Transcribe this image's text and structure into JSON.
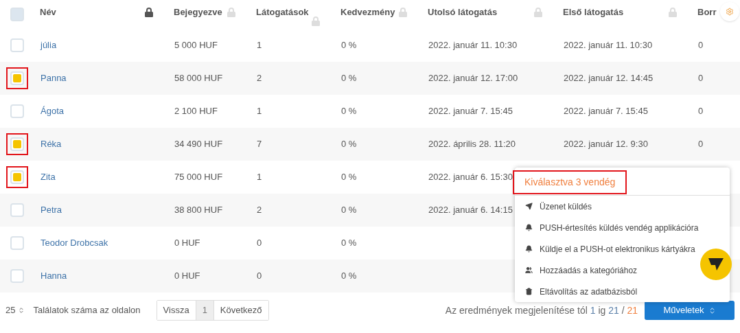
{
  "header_checkbox": {
    "checked": false
  },
  "columns": [
    {
      "label": "Név",
      "locked": true
    },
    {
      "label": "Bejegyezve",
      "locked": false
    },
    {
      "label": "Látogatások",
      "locked": false
    },
    {
      "label": "Kedvezmény",
      "locked": false
    },
    {
      "label": "Utolsó látogatás",
      "locked": false
    },
    {
      "label": "Első látogatás",
      "locked": false
    },
    {
      "label": "Borr"
    }
  ],
  "rows": [
    {
      "checked": false,
      "cells": [
        "júlia",
        "5 000 HUF",
        "1",
        "0 %",
        "2022. január 11. 10:30",
        "2022. január 11. 10:30",
        "0"
      ]
    },
    {
      "checked": true,
      "cells": [
        "Panna",
        "58 000 HUF",
        "2",
        "0 %",
        "2022. január 12. 17:00",
        "2022. január 12. 14:45",
        "0"
      ]
    },
    {
      "checked": false,
      "cells": [
        "Ágota",
        "2 100 HUF",
        "1",
        "0 %",
        "2022. január 7. 15:45",
        "2022. január 7. 15:45",
        "0"
      ]
    },
    {
      "checked": true,
      "cells": [
        "Réka",
        "34 490 HUF",
        "7",
        "0 %",
        "2022. április 28. 11:20",
        "2022. január 12. 9:30",
        "0"
      ]
    },
    {
      "checked": true,
      "cells": [
        "Zita",
        "75 000 HUF",
        "1",
        "0 %",
        "2022. január 6. 15:30",
        null,
        null
      ]
    },
    {
      "checked": false,
      "cells": [
        "Petra",
        "38 800 HUF",
        "2",
        "0 %",
        "2022. január 6. 14:15",
        null,
        null
      ]
    },
    {
      "checked": false,
      "cells": [
        "Teodor Drobcsak",
        "0 HUF",
        "0",
        "0 %",
        null,
        null,
        null
      ]
    },
    {
      "checked": false,
      "cells": [
        "Hanna",
        "0 HUF",
        "0",
        "0 %",
        null,
        null,
        null
      ]
    }
  ],
  "menu": {
    "title": "Kiválasztva 3 vendég",
    "items": [
      {
        "kind": "send",
        "label": "Üzenet küldés"
      },
      {
        "kind": "bell",
        "label": "PUSH-értesítés küldés vendég applikációra"
      },
      {
        "kind": "bell",
        "label": "Küldje el a PUSH-ot elektronikus kártyákra"
      },
      {
        "kind": "users",
        "label": "Hozzáadás a kategóriához"
      },
      {
        "kind": "trash",
        "label": "Eltávolítás az adatbázisból"
      }
    ]
  },
  "footer": {
    "page_size": "25",
    "page_size_label": "Találatok száma az oldalon",
    "pagination": [
      {
        "label": "Vissza",
        "selected": false
      },
      {
        "label": "1",
        "selected": true
      },
      {
        "label": "Következő",
        "selected": false
      }
    ],
    "results": {
      "prefix": "Az eredmények megjelenítése tól",
      "from": "1",
      "mid": "ig",
      "to": "21",
      "sep": "/",
      "total": "21"
    },
    "actions_button": "Műveletek"
  }
}
